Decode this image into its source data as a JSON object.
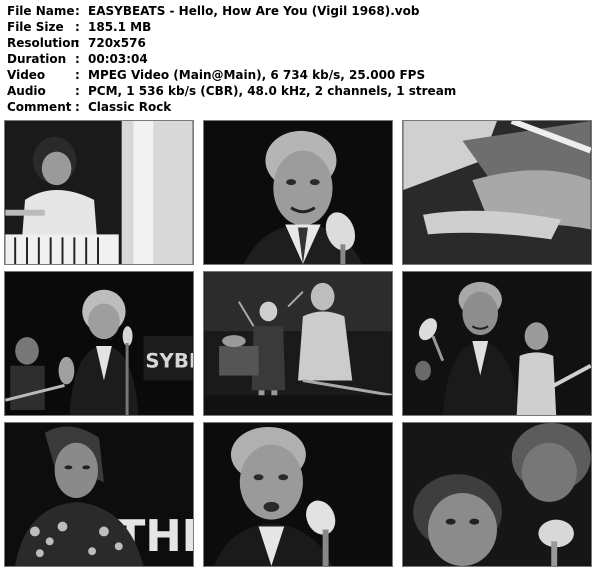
{
  "metadata": [
    {
      "key": "File Name",
      "value": "EASYBEATS - Hello, How Are You (Vigil 1968).vob"
    },
    {
      "key": "File Size",
      "value": "185.1 MB"
    },
    {
      "key": "Resolution",
      "value": "720x576"
    },
    {
      "key": "Duration",
      "value": "00:03:04"
    },
    {
      "key": "Video",
      "value": "MPEG Video (Main@Main), 6 734 kb/s, 25.000 FPS"
    },
    {
      "key": "Audio",
      "value": "PCM, 1 536 kb/s (CBR), 48.0 kHz, 2 channels, 1 stream"
    },
    {
      "key": "Comment",
      "value": "Classic Rock"
    }
  ],
  "separator": ":",
  "thumbnails": [
    {
      "scene": "pianist-at-keyboard"
    },
    {
      "scene": "singer-at-microphone"
    },
    {
      "scene": "hands-close-up"
    },
    {
      "scene": "singer-with-band-backdrop",
      "backdrop_text": "SYBEA"
    },
    {
      "scene": "band-on-stage"
    },
    {
      "scene": "singer-with-guitarist"
    },
    {
      "scene": "guitarist-with-backdrop",
      "backdrop_text": "THE"
    },
    {
      "scene": "singer-close-up-microphone"
    },
    {
      "scene": "blurred-face-microphone"
    }
  ]
}
